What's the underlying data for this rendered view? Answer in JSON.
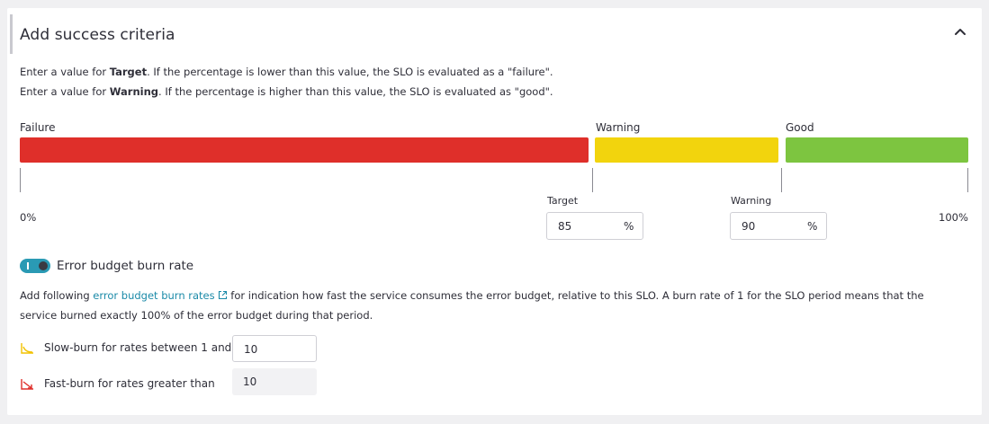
{
  "section": {
    "title": "Add success criteria"
  },
  "intro": {
    "line1_prefix": "Enter a value for ",
    "line1_bold": "Target",
    "line1_suffix": ". If the percentage is lower than this value, the SLO is evaluated as a \"failure\".",
    "line2_prefix": "Enter a value for ",
    "line2_bold": "Warning",
    "line2_suffix": ". If the percentage is higher than this value, the SLO is evaluated as \"good\"."
  },
  "scale": {
    "segments": [
      {
        "label": "Failure",
        "color": "#df2f2a"
      },
      {
        "label": "Warning",
        "color": "#f2d40d"
      },
      {
        "label": "Good",
        "color": "#7dc540"
      }
    ],
    "min_label": "0%",
    "max_label": "100%",
    "target": {
      "label": "Target",
      "value": "85",
      "unit": "%"
    },
    "warning": {
      "label": "Warning",
      "value": "90",
      "unit": "%"
    }
  },
  "burn_rate": {
    "toggle_label": "Error budget burn rate",
    "enabled": true,
    "desc_prefix": "Add following ",
    "desc_link": "error budget burn rates",
    "desc_suffix": " for indication how fast the service consumes the error budget, relative to this SLO. A burn rate of 1 for the SLO period means that the",
    "desc_line2": "service burned exactly 100% of the error budget during that period.",
    "slow": {
      "label": "Slow-burn for rates between 1 and",
      "value": "10",
      "icon": "slow-burn-icon",
      "color": "#f2d40d"
    },
    "fast": {
      "label": "Fast-burn for rates greater than",
      "value": "10",
      "icon": "fast-burn-icon",
      "color": "#df2f2a"
    }
  }
}
